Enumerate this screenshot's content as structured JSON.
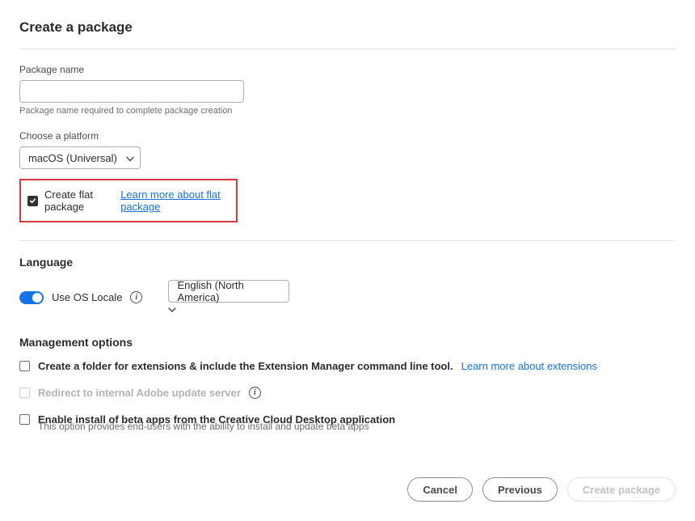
{
  "title": "Create a package",
  "package_name": {
    "label": "Package name",
    "value": "",
    "helper": "Package name required to complete package creation"
  },
  "platform": {
    "label": "Choose a platform",
    "selected": "macOS (Universal)"
  },
  "flat_package": {
    "checked": true,
    "label": "Create flat package",
    "learn_more": "Learn more about flat package"
  },
  "language": {
    "heading": "Language",
    "toggle_label": "Use OS Locale",
    "toggle_on": true,
    "selected": "English (North America)"
  },
  "management": {
    "heading": "Management options",
    "extensions": {
      "checked": false,
      "label": "Create a folder for extensions & include the Extension Manager command line tool.",
      "learn_more": "Learn more about extensions"
    },
    "redirect": {
      "checked": false,
      "disabled": true,
      "label": "Redirect to internal Adobe update server"
    },
    "beta": {
      "checked": false,
      "label": "Enable install of beta apps from the Creative Cloud Desktop application",
      "helper": "This option provides end-users with the ability to install and update beta apps"
    }
  },
  "footer": {
    "cancel": "Cancel",
    "previous": "Previous",
    "create": "Create package"
  }
}
